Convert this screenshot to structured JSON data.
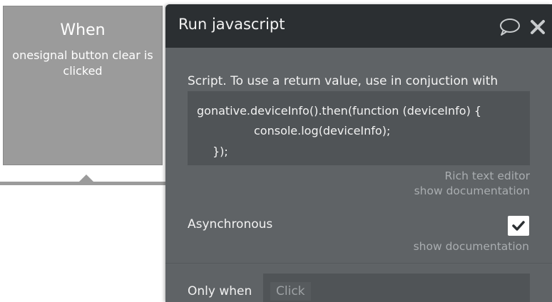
{
  "event": {
    "when_label": "When",
    "description": "onesignal button clear is clicked"
  },
  "panel": {
    "title": "Run javascript",
    "icons": {
      "comment": "speech-bubble-icon",
      "close": "close-icon"
    },
    "script_label": "Script. To use a return value, use in conjuction with",
    "script_lines": [
      "gonative.deviceInfo().then(function (deviceInfo) {",
      "console.log(deviceInfo);",
      "});"
    ],
    "rich_text_editor": "Rich text editor",
    "show_documentation": "show documentation",
    "asynchronous_label": "Asynchronous",
    "asynchronous_checked": true,
    "show_documentation_2": "show documentation",
    "only_when_label": "Only when",
    "only_when_placeholder": "Click"
  },
  "colors": {
    "panel_bg": "#5f6366",
    "header_bg": "#2b2f32",
    "event_card_bg": "#9b9b9b"
  }
}
